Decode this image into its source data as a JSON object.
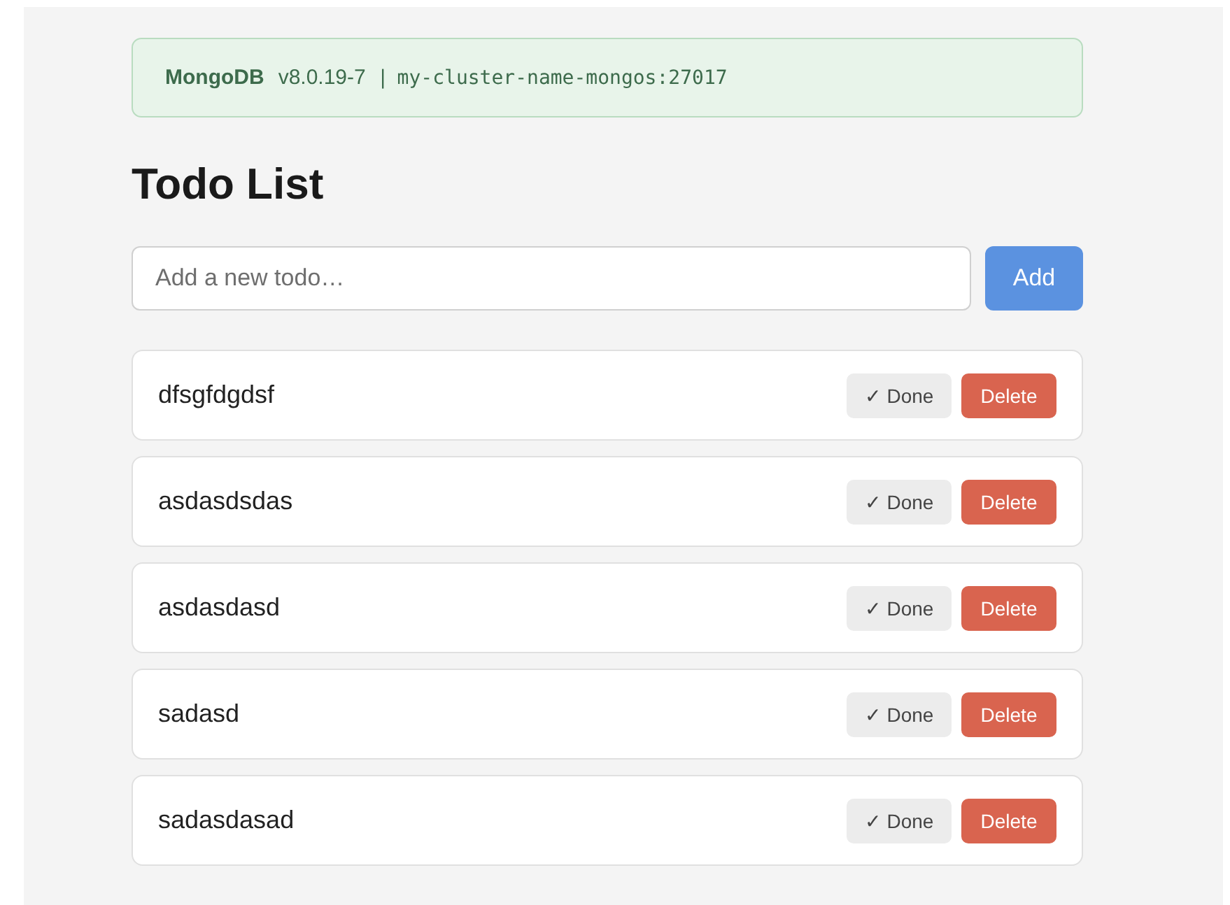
{
  "banner": {
    "name": "MongoDB",
    "version": "v8.0.19-7",
    "separator": "|",
    "host": "my-cluster-name-mongos:27017"
  },
  "title": "Todo List",
  "new_todo": {
    "placeholder": "Add a new todo…",
    "button": "Add"
  },
  "todos": [
    {
      "text": "dfsgfdgdsf",
      "done": false,
      "done_button": "✓ Done",
      "delete_button": "Delete"
    },
    {
      "text": "asdasdsdas",
      "done": false,
      "done_button": "✓ Done",
      "delete_button": "Delete"
    },
    {
      "text": "asdasdasd",
      "done": false,
      "done_button": "✓ Done",
      "delete_button": "Delete"
    },
    {
      "text": "sadasd",
      "done": false,
      "done_button": "✓ Done",
      "delete_button": "Delete"
    },
    {
      "text": "sadasdasad",
      "done": false,
      "done_button": "✓ Done",
      "delete_button": "Delete"
    }
  ]
}
